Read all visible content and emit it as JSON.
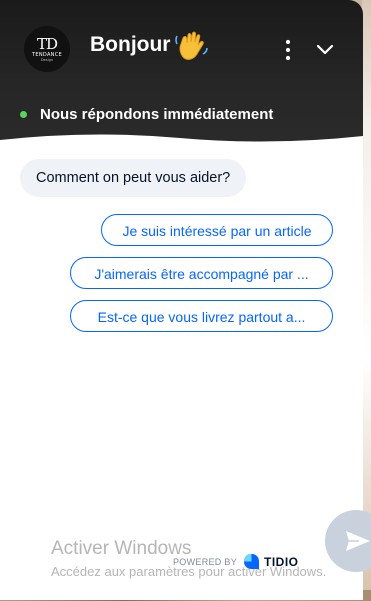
{
  "header": {
    "logo_mono": "TD",
    "logo_text": "TENDANCE",
    "logo_sub": "Design",
    "title": "Bonjour",
    "wave_emoji": "👋",
    "status_text": "Nous répondons immédiatement"
  },
  "chat": {
    "greeting": "Comment on peut vous aider?",
    "options": [
      "Je suis intéressé par un article",
      "J'aimerais être accompagné par ...",
      "Est-ce que vous livrez partout a..."
    ]
  },
  "footer": {
    "powered_label": "POWERED BY",
    "brand": "TIDIO"
  },
  "windows_watermark": {
    "title": "Activer Windows",
    "subtitle": "Accédez aux paramètres pour activer Windows."
  },
  "icons": {
    "menu": "more-vertical-icon",
    "collapse": "chevron-down-icon",
    "send": "send-icon",
    "brand": "tidio-icon"
  },
  "colors": {
    "header_bg": "#1f1f1f",
    "accent": "#0566ff",
    "status_online": "#5ad45a",
    "bubble_bg": "#eff2f6"
  }
}
